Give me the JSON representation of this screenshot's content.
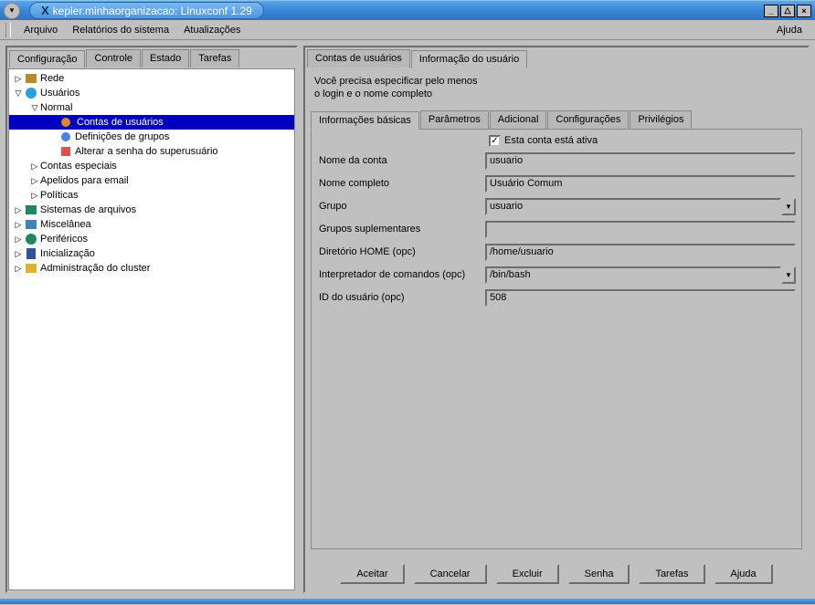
{
  "window": {
    "title": "kepler.minhaorganizacao: Linuxconf 1.29",
    "minimize_glyph": "_",
    "maximize_glyph": "△",
    "close_glyph": "×"
  },
  "menubar": {
    "arquivo": "Arquivo",
    "relatorios": "Relatórios do sistema",
    "atualizacoes": "Atualizações",
    "ajuda": "Ajuda"
  },
  "left_tabs": {
    "configuracao": "Configuração",
    "controle": "Controle",
    "estado": "Estado",
    "tarefas": "Tarefas"
  },
  "tree": {
    "rede": "Rede",
    "usuarios": "Usuários",
    "normal": "Normal",
    "contas_usuarios": "Contas de usuários",
    "definicoes_grupos": "Definições de grupos",
    "alterar_senha_super": "Alterar a senha do superusuário",
    "contas_especiais": "Contas especiais",
    "apelidos_email": "Apelidos para email",
    "politicas": "Políticas",
    "sistemas_arquivos": "Sistemas de arquivos",
    "miscelanea": "Miscelânea",
    "perifericos": "Periféricos",
    "inicializacao": "Inicialização",
    "admin_cluster": "Administração do cluster"
  },
  "right_tabs": {
    "contas_usuarios": "Contas de usuários",
    "informacao_usuario": "Informação do usuário"
  },
  "info": {
    "line1": "Você precisa especificar pelo menos",
    "line2": "o login e o nome completo"
  },
  "inner_tabs": {
    "informacoes_basicas": "Informações básicas",
    "parametros": "Parâmetros",
    "adicional": "Adicional",
    "configuracoes": "Configurações",
    "privilegios": "Privilégios"
  },
  "form": {
    "active_checkbox": {
      "checked": true,
      "label": "Esta conta está ativa"
    },
    "nome_conta": {
      "label": "Nome da conta",
      "value": "usuario"
    },
    "nome_completo": {
      "label": "Nome completo",
      "value": "Usuário Comum"
    },
    "grupo": {
      "label": "Grupo",
      "value": "usuario"
    },
    "grupos_supl": {
      "label": "Grupos suplementares",
      "value": ""
    },
    "home_dir": {
      "label": "Diretório HOME (opc)",
      "value": "/home/usuario"
    },
    "interpretador": {
      "label": "Interpretador de comandos (opc)",
      "value": "/bin/bash"
    },
    "id_usuario": {
      "label": "ID do usuário (opc)",
      "value": "508"
    }
  },
  "buttons": {
    "aceitar": "Aceitar",
    "cancelar": "Cancelar",
    "excluir": "Excluir",
    "senha": "Senha",
    "tarefas": "Tarefas",
    "ajuda": "Ajuda"
  },
  "glyphs": {
    "caret_right": "▷",
    "caret_down": "▽",
    "dropdown": "▼",
    "check": "✓"
  }
}
